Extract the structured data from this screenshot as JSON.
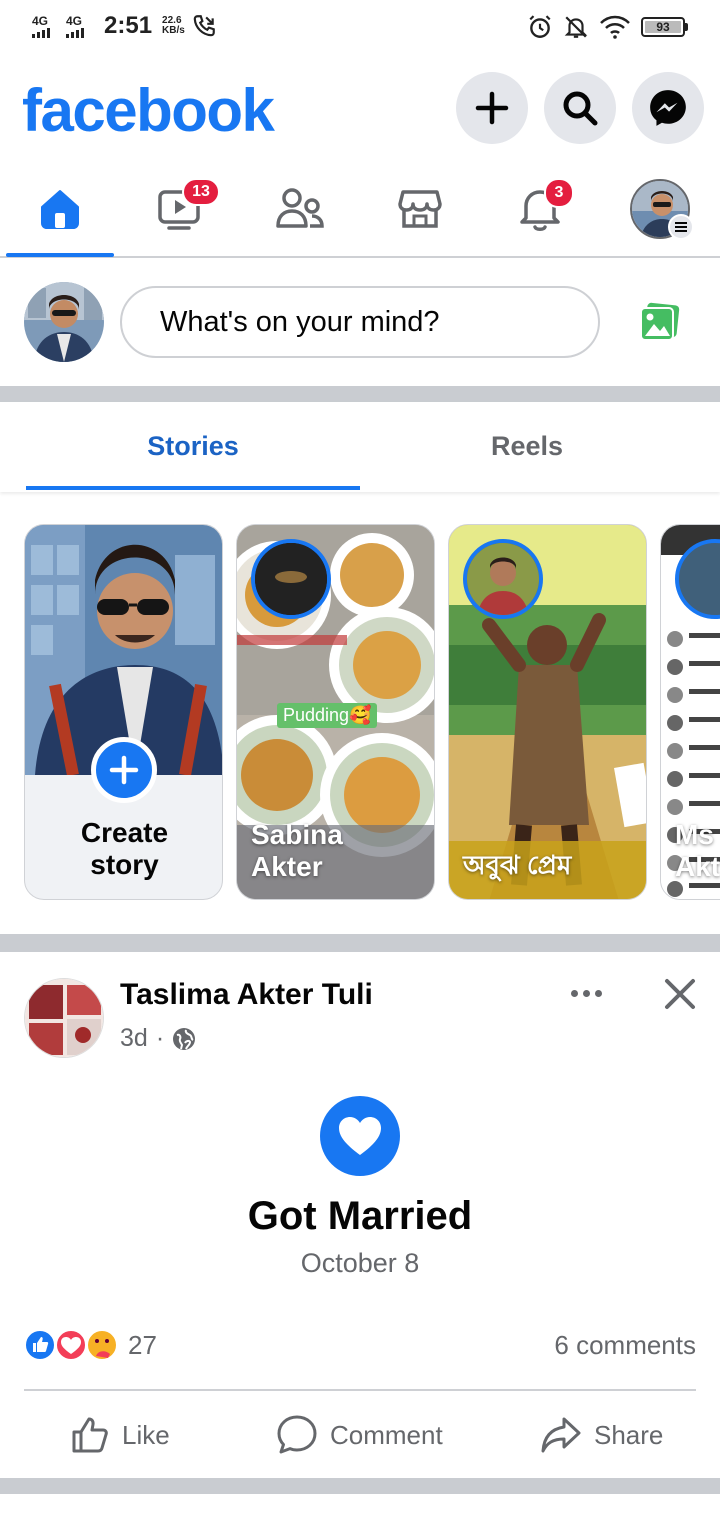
{
  "status_bar": {
    "net1": "4G",
    "net2": "4G",
    "time": "2:51",
    "speed_value": "22.6",
    "speed_unit": "KB/s",
    "battery": "93"
  },
  "header": {
    "logo": "facebook",
    "icons": [
      "plus-icon",
      "search-icon",
      "messenger-icon"
    ]
  },
  "nav": {
    "items": [
      {
        "name": "home",
        "badge": ""
      },
      {
        "name": "watch",
        "badge": "13"
      },
      {
        "name": "friends",
        "badge": ""
      },
      {
        "name": "marketplace",
        "badge": ""
      },
      {
        "name": "notifications",
        "badge": "3"
      },
      {
        "name": "menu",
        "badge": ""
      }
    ]
  },
  "composer": {
    "placeholder": "What's on your mind?"
  },
  "story_tabs": {
    "stories": "Stories",
    "reels": "Reels"
  },
  "stories": {
    "create_line1": "Create",
    "create_line2": "story",
    "cards": [
      {
        "name_line1": "Sabina",
        "name_line2": "Akter",
        "sticker": "Pudding🥰"
      },
      {
        "caption": "অবুঝ প্রেম"
      },
      {
        "name_line1": "Ms",
        "name_line2": "Akt"
      }
    ]
  },
  "post": {
    "author": "Taslima Akter Tuli",
    "time": "3d",
    "separator": "·",
    "event_title": "Got Married",
    "event_date": "October 8",
    "reaction_count": "27",
    "comments": "6 comments",
    "actions": {
      "like": "Like",
      "comment": "Comment",
      "share": "Share"
    }
  },
  "colors": {
    "brand": "#1877f2",
    "badge": "#e41e3f",
    "secondary_text": "#65676b"
  }
}
